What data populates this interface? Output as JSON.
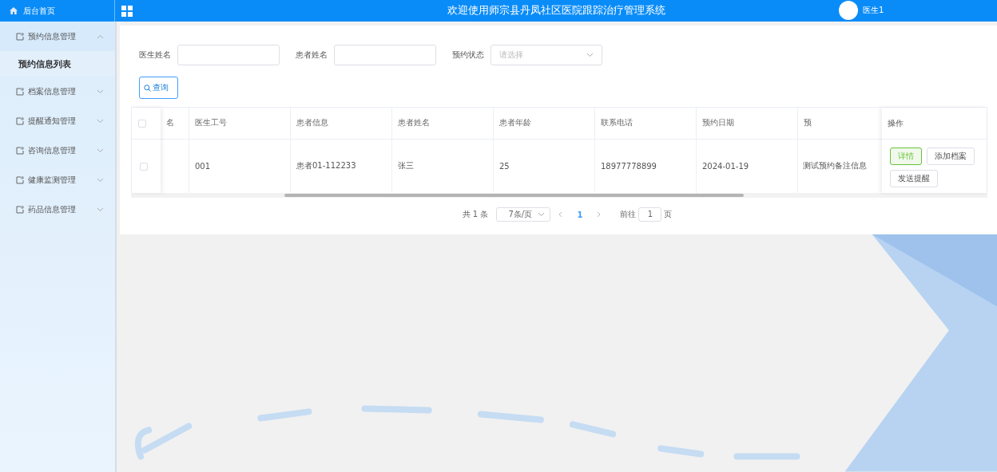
{
  "header": {
    "title": "欢迎使用师宗县丹凤社区医院跟踪治疗管理系统",
    "user": "医生1"
  },
  "sidebar": {
    "home": "后台首页",
    "menus": [
      {
        "label": "预约信息管理",
        "expanded": true,
        "children": [
          {
            "label": "预约信息列表",
            "selected": true
          }
        ]
      },
      {
        "label": "档案信息管理",
        "expanded": false
      },
      {
        "label": "提醒通知管理",
        "expanded": false
      },
      {
        "label": "咨询信息管理",
        "expanded": false
      },
      {
        "label": "健康监测管理",
        "expanded": false
      },
      {
        "label": "药品信息管理",
        "expanded": false
      }
    ]
  },
  "search": {
    "fields": [
      {
        "kind": "text",
        "label": "医生姓名"
      },
      {
        "kind": "text",
        "label": "患者姓名"
      },
      {
        "kind": "select",
        "label": "预约状态",
        "placeholder": "请选择"
      }
    ],
    "button": "查询"
  },
  "table": {
    "header_checked": false,
    "columns": [
      "名",
      "医生工号",
      "患者信息",
      "患者姓名",
      "患者年龄",
      "联系电话",
      "预约日期",
      "预"
    ],
    "action_column": "操作",
    "rows": [
      {
        "checked": false,
        "cells": [
          "",
          "001",
          "患者01-112233",
          "张三",
          "25",
          "18977778899",
          "2024-01-19",
          "测试预约备注信息"
        ],
        "actions": [
          {
            "label": "详情",
            "kind": "success"
          },
          {
            "label": "添加档案",
            "kind": "default"
          },
          {
            "label": "发送提醒",
            "kind": "default"
          }
        ]
      }
    ]
  },
  "pagination": {
    "total": "共 1 条",
    "page_size": "7条/页",
    "pages": [
      {
        "label": "1",
        "selected": true
      }
    ],
    "goto_label": "前往",
    "goto_value": "1",
    "goto_suffix": "页"
  }
}
